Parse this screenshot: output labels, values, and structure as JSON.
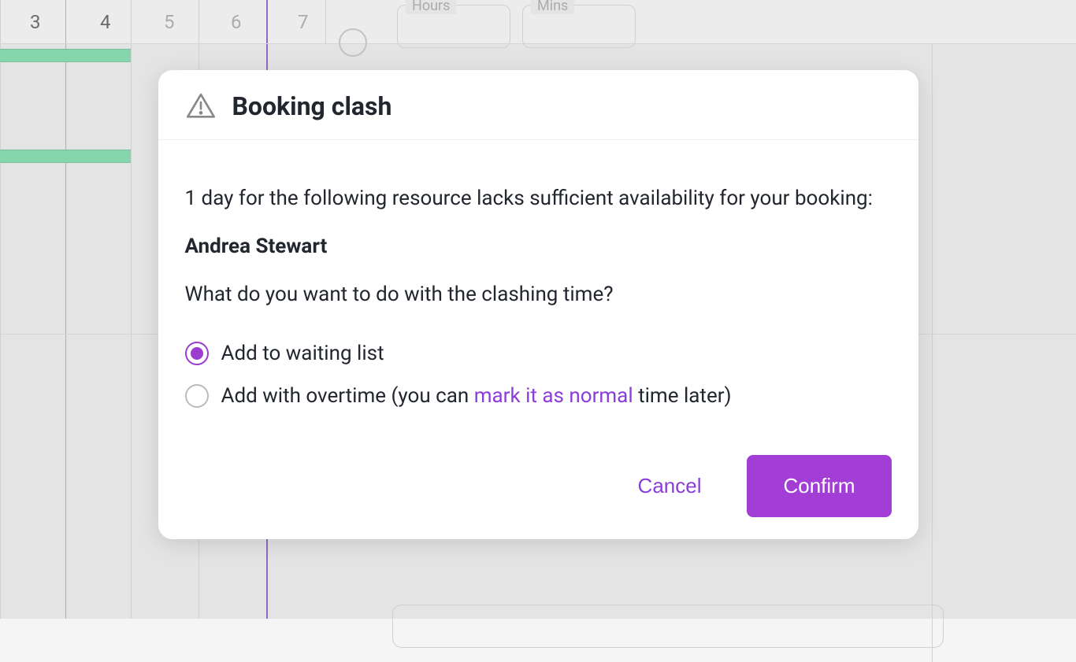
{
  "background": {
    "numbers": [
      "3",
      "4",
      "5",
      "6",
      "7"
    ],
    "numberPositions": [
      38,
      127,
      208,
      293,
      378
    ],
    "grayStart": 2,
    "fields": {
      "hours": "Hours",
      "mins": "Mins"
    }
  },
  "modal": {
    "title": "Booking clash",
    "message": "1 day for the following resource lacks sufficient availability for your booking:",
    "resource": "Andrea Stewart",
    "question": "What do you want to do with the clashing time?",
    "options": {
      "waiting": "Add to waiting list",
      "overtime_prefix": "Add with overtime (you can ",
      "overtime_link": "mark it as normal",
      "overtime_suffix": " time later)"
    },
    "buttons": {
      "cancel": "Cancel",
      "confirm": "Confirm"
    }
  }
}
